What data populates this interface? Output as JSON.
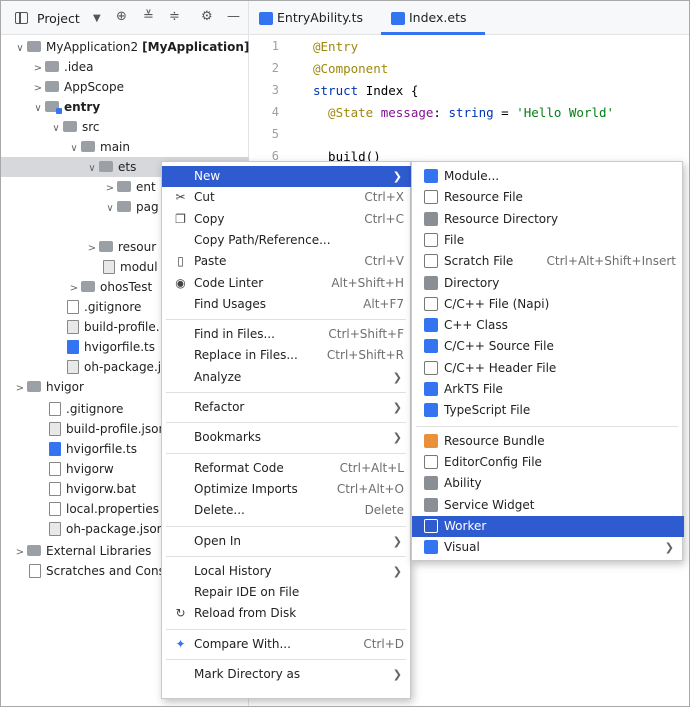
{
  "project_bar": {
    "label": "Project",
    "icons": [
      "chevron-down-icon",
      "target-icon",
      "collapse-all-icon",
      "expand-all-icon",
      "gear-icon",
      "minimize-icon"
    ]
  },
  "tree": {
    "items": [
      {
        "label": "MyApplication2",
        "module": "[MyApplication]"
      },
      {
        "label": ".idea"
      },
      {
        "label": "AppScope"
      },
      {
        "label": "entry"
      },
      {
        "label": "src"
      },
      {
        "label": "main"
      },
      {
        "label": "ets"
      },
      {
        "label": "ent"
      },
      {
        "label": "pag"
      },
      {
        "label": "resour"
      },
      {
        "label": "modul"
      },
      {
        "label": "ohosTest"
      },
      {
        "label": ".gitignore"
      },
      {
        "label": "build-profile."
      },
      {
        "label": "hvigorfile.ts"
      },
      {
        "label": "oh-package.j"
      },
      {
        "label": "hvigor"
      },
      {
        "label": ".gitignore"
      },
      {
        "label": "build-profile.json"
      },
      {
        "label": "hvigorfile.ts"
      },
      {
        "label": "hvigorw"
      },
      {
        "label": "hvigorw.bat"
      },
      {
        "label": "local.properties"
      },
      {
        "label": "oh-package.json"
      },
      {
        "label": "External Libraries"
      },
      {
        "label": "Scratches and Cons"
      }
    ]
  },
  "tabs": [
    {
      "label": "EntryAbility.ts",
      "close": "×"
    },
    {
      "label": "Index.ets",
      "close": "×"
    }
  ],
  "editor": {
    "line_numbers": [
      "1",
      "2",
      "3",
      "4",
      "5",
      "6"
    ],
    "lines": [
      {
        "parts": [
          {
            "t": "@Entry",
            "c": "ann"
          }
        ]
      },
      {
        "parts": [
          {
            "t": "@Component",
            "c": "ann"
          }
        ]
      },
      {
        "parts": [
          {
            "t": "struct ",
            "c": "kw"
          },
          {
            "t": "Index ",
            "c": "ty"
          },
          {
            "t": "{",
            "c": "ty"
          }
        ]
      },
      {
        "parts": [
          {
            "t": "  @State ",
            "c": "ann"
          },
          {
            "t": "message",
            "c": "fld"
          },
          {
            "t": ": ",
            "c": "ty"
          },
          {
            "t": "string",
            "c": "kw"
          },
          {
            "t": " = ",
            "c": "ty"
          },
          {
            "t": "'Hello World'",
            "c": "str"
          }
        ]
      },
      {
        "parts": []
      },
      {
        "parts": [
          {
            "t": "  build() ",
            "c": "ty"
          }
        ]
      }
    ]
  },
  "context_menu": {
    "items": [
      {
        "label": "New",
        "hl": true,
        "sub": true
      },
      {
        "label": "Cut",
        "shortcut": "Ctrl+X",
        "icon": "scissors-icon",
        "glyph": "✂"
      },
      {
        "label": "Copy",
        "shortcut": "Ctrl+C",
        "icon": "copy-icon",
        "glyph": "❐"
      },
      {
        "label": "Copy Path/Reference..."
      },
      {
        "label": "Paste",
        "shortcut": "Ctrl+V",
        "icon": "paste-icon",
        "glyph": "▯"
      },
      {
        "label": "Code Linter",
        "shortcut": "Alt+Shift+H",
        "icon": "code-linter-icon",
        "glyph": "◉"
      },
      {
        "label": "Find Usages",
        "shortcut": "Alt+F7"
      },
      {
        "sep": true
      },
      {
        "label": "Find in Files...",
        "shortcut": "Ctrl+Shift+F"
      },
      {
        "label": "Replace in Files...",
        "shortcut": "Ctrl+Shift+R"
      },
      {
        "label": "Analyze",
        "sub": true
      },
      {
        "sep": true
      },
      {
        "label": "Refactor",
        "sub": true
      },
      {
        "sep": true
      },
      {
        "label": "Bookmarks",
        "sub": true
      },
      {
        "sep": true
      },
      {
        "label": "Reformat Code",
        "shortcut": "Ctrl+Alt+L"
      },
      {
        "label": "Optimize Imports",
        "shortcut": "Ctrl+Alt+O"
      },
      {
        "label": "Delete...",
        "shortcut": "Delete"
      },
      {
        "sep": true
      },
      {
        "label": "Open In",
        "sub": true
      },
      {
        "sep": true
      },
      {
        "label": "Local History",
        "sub": true
      },
      {
        "label": "Repair IDE on File"
      },
      {
        "label": "Reload from Disk",
        "icon": "reload-icon",
        "glyph": "↻"
      },
      {
        "sep": true
      },
      {
        "label": "Compare With...",
        "shortcut": "Ctrl+D",
        "icon": "compare-icon",
        "glyph": "✦"
      },
      {
        "sep": true
      },
      {
        "label": "Mark Directory as",
        "sub": true
      }
    ]
  },
  "new_submenu": {
    "items": [
      {
        "label": "Module...",
        "icon": "module-icon",
        "k": "b"
      },
      {
        "label": "Resource File",
        "icon": "resource-file-icon",
        "k": "f"
      },
      {
        "label": "Resource Directory",
        "icon": "folder-icon",
        "k": "g"
      },
      {
        "label": "File",
        "icon": "file-icon",
        "k": "f"
      },
      {
        "label": "Scratch File",
        "shortcut": "Ctrl+Alt+Shift+Insert",
        "icon": "scratch-file-icon",
        "k": "f"
      },
      {
        "label": "Directory",
        "icon": "folder-icon",
        "k": "g"
      },
      {
        "label": "C/C++ File (Napi)",
        "icon": "napi-file-icon",
        "k": "f"
      },
      {
        "label": "C++ Class",
        "icon": "cpp-class-icon",
        "k": "b"
      },
      {
        "label": "C/C++ Source File",
        "icon": "cpp-source-icon",
        "k": "b"
      },
      {
        "label": "C/C++ Header File",
        "icon": "cpp-header-icon",
        "k": "f"
      },
      {
        "label": "ArkTS File",
        "icon": "arkts-file-icon",
        "k": "b"
      },
      {
        "label": "TypeScript File",
        "icon": "typescript-file-icon",
        "k": "b"
      },
      {
        "sep": true
      },
      {
        "label": "Resource Bundle",
        "icon": "resource-bundle-icon",
        "k": "o"
      },
      {
        "label": "EditorConfig File",
        "icon": "editorconfig-icon",
        "k": "f"
      },
      {
        "label": "Ability",
        "icon": "ability-icon",
        "k": "g"
      },
      {
        "label": "Service Widget",
        "icon": "service-widget-icon",
        "k": "g"
      },
      {
        "label": "Worker",
        "icon": "worker-icon",
        "hl": true,
        "k": "w"
      },
      {
        "label": "Visual",
        "icon": "visual-icon",
        "sub": true,
        "k": "b"
      }
    ]
  },
  "colors": {
    "accent": "#3574f0",
    "highlight": "#2f5bd0",
    "selection": "#d6d8dc"
  }
}
